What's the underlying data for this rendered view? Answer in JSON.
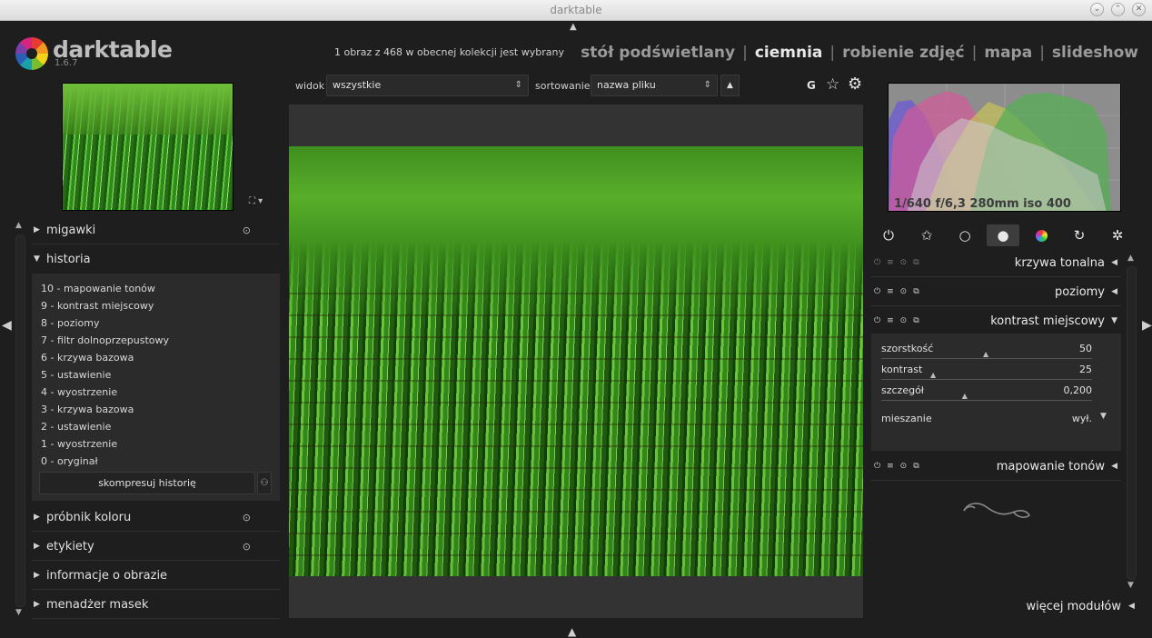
{
  "window": {
    "title": "darktable"
  },
  "header": {
    "app_name": "darktable",
    "version": "1.6.7",
    "collection_info": "1 obraz z 468 w obecnej kolekcji jest wybrany",
    "views": [
      "stół podświetlany",
      "ciemnia",
      "robienie zdjęć",
      "mapa",
      "slideshow"
    ],
    "active_view": "ciemnia"
  },
  "toolbar": {
    "view_label": "widok",
    "view_value": "wszystkie",
    "sort_label": "sortowanie",
    "sort_value": "nazwa pliku",
    "grouping": "G"
  },
  "left_panel": {
    "modules": [
      {
        "label": "migawki",
        "expanded": false
      },
      {
        "label": "historia",
        "expanded": true
      },
      {
        "label": "próbnik koloru",
        "expanded": false
      },
      {
        "label": "etykiety",
        "expanded": false
      },
      {
        "label": "informacje o obrazie",
        "expanded": false
      },
      {
        "label": "menadżer masek",
        "expanded": false
      }
    ],
    "history": [
      "10 - mapowanie tonów",
      "9 - kontrast miejscowy",
      "8 - poziomy",
      "7 - filtr dolnoprzepustowy",
      "6 - krzywa bazowa",
      "5 - ustawienie",
      "4 - wyostrzenie",
      "3 - krzywa bazowa",
      "2 - ustawienie",
      "1 - wyostrzenie",
      "0 - oryginał"
    ],
    "compress_label": "skompresuj historię"
  },
  "right_panel": {
    "exif": "1/640 f/6,3 280mm iso 400",
    "module_groups": [
      "power-icon",
      "star-icon",
      "circle-icon",
      "filled-circle-icon",
      "color-icon",
      "rotate-icon",
      "effect-icon"
    ],
    "modules": [
      {
        "label": "krzywa tonalna",
        "expanded": false
      },
      {
        "label": "poziomy",
        "expanded": false
      },
      {
        "label": "kontrast miejscowy",
        "expanded": true
      },
      {
        "label": "mapowanie tonów",
        "expanded": false
      }
    ],
    "local_contrast": {
      "sliders": [
        {
          "label": "szorstkość",
          "value": "50",
          "fraction": 0.5
        },
        {
          "label": "kontrast",
          "value": "25",
          "fraction": 0.25
        },
        {
          "label": "szczegół",
          "value": "0,200",
          "fraction": 0.4
        }
      ],
      "blend_label": "mieszanie",
      "blend_value": "wył."
    },
    "more_modules": "więcej modułów"
  }
}
